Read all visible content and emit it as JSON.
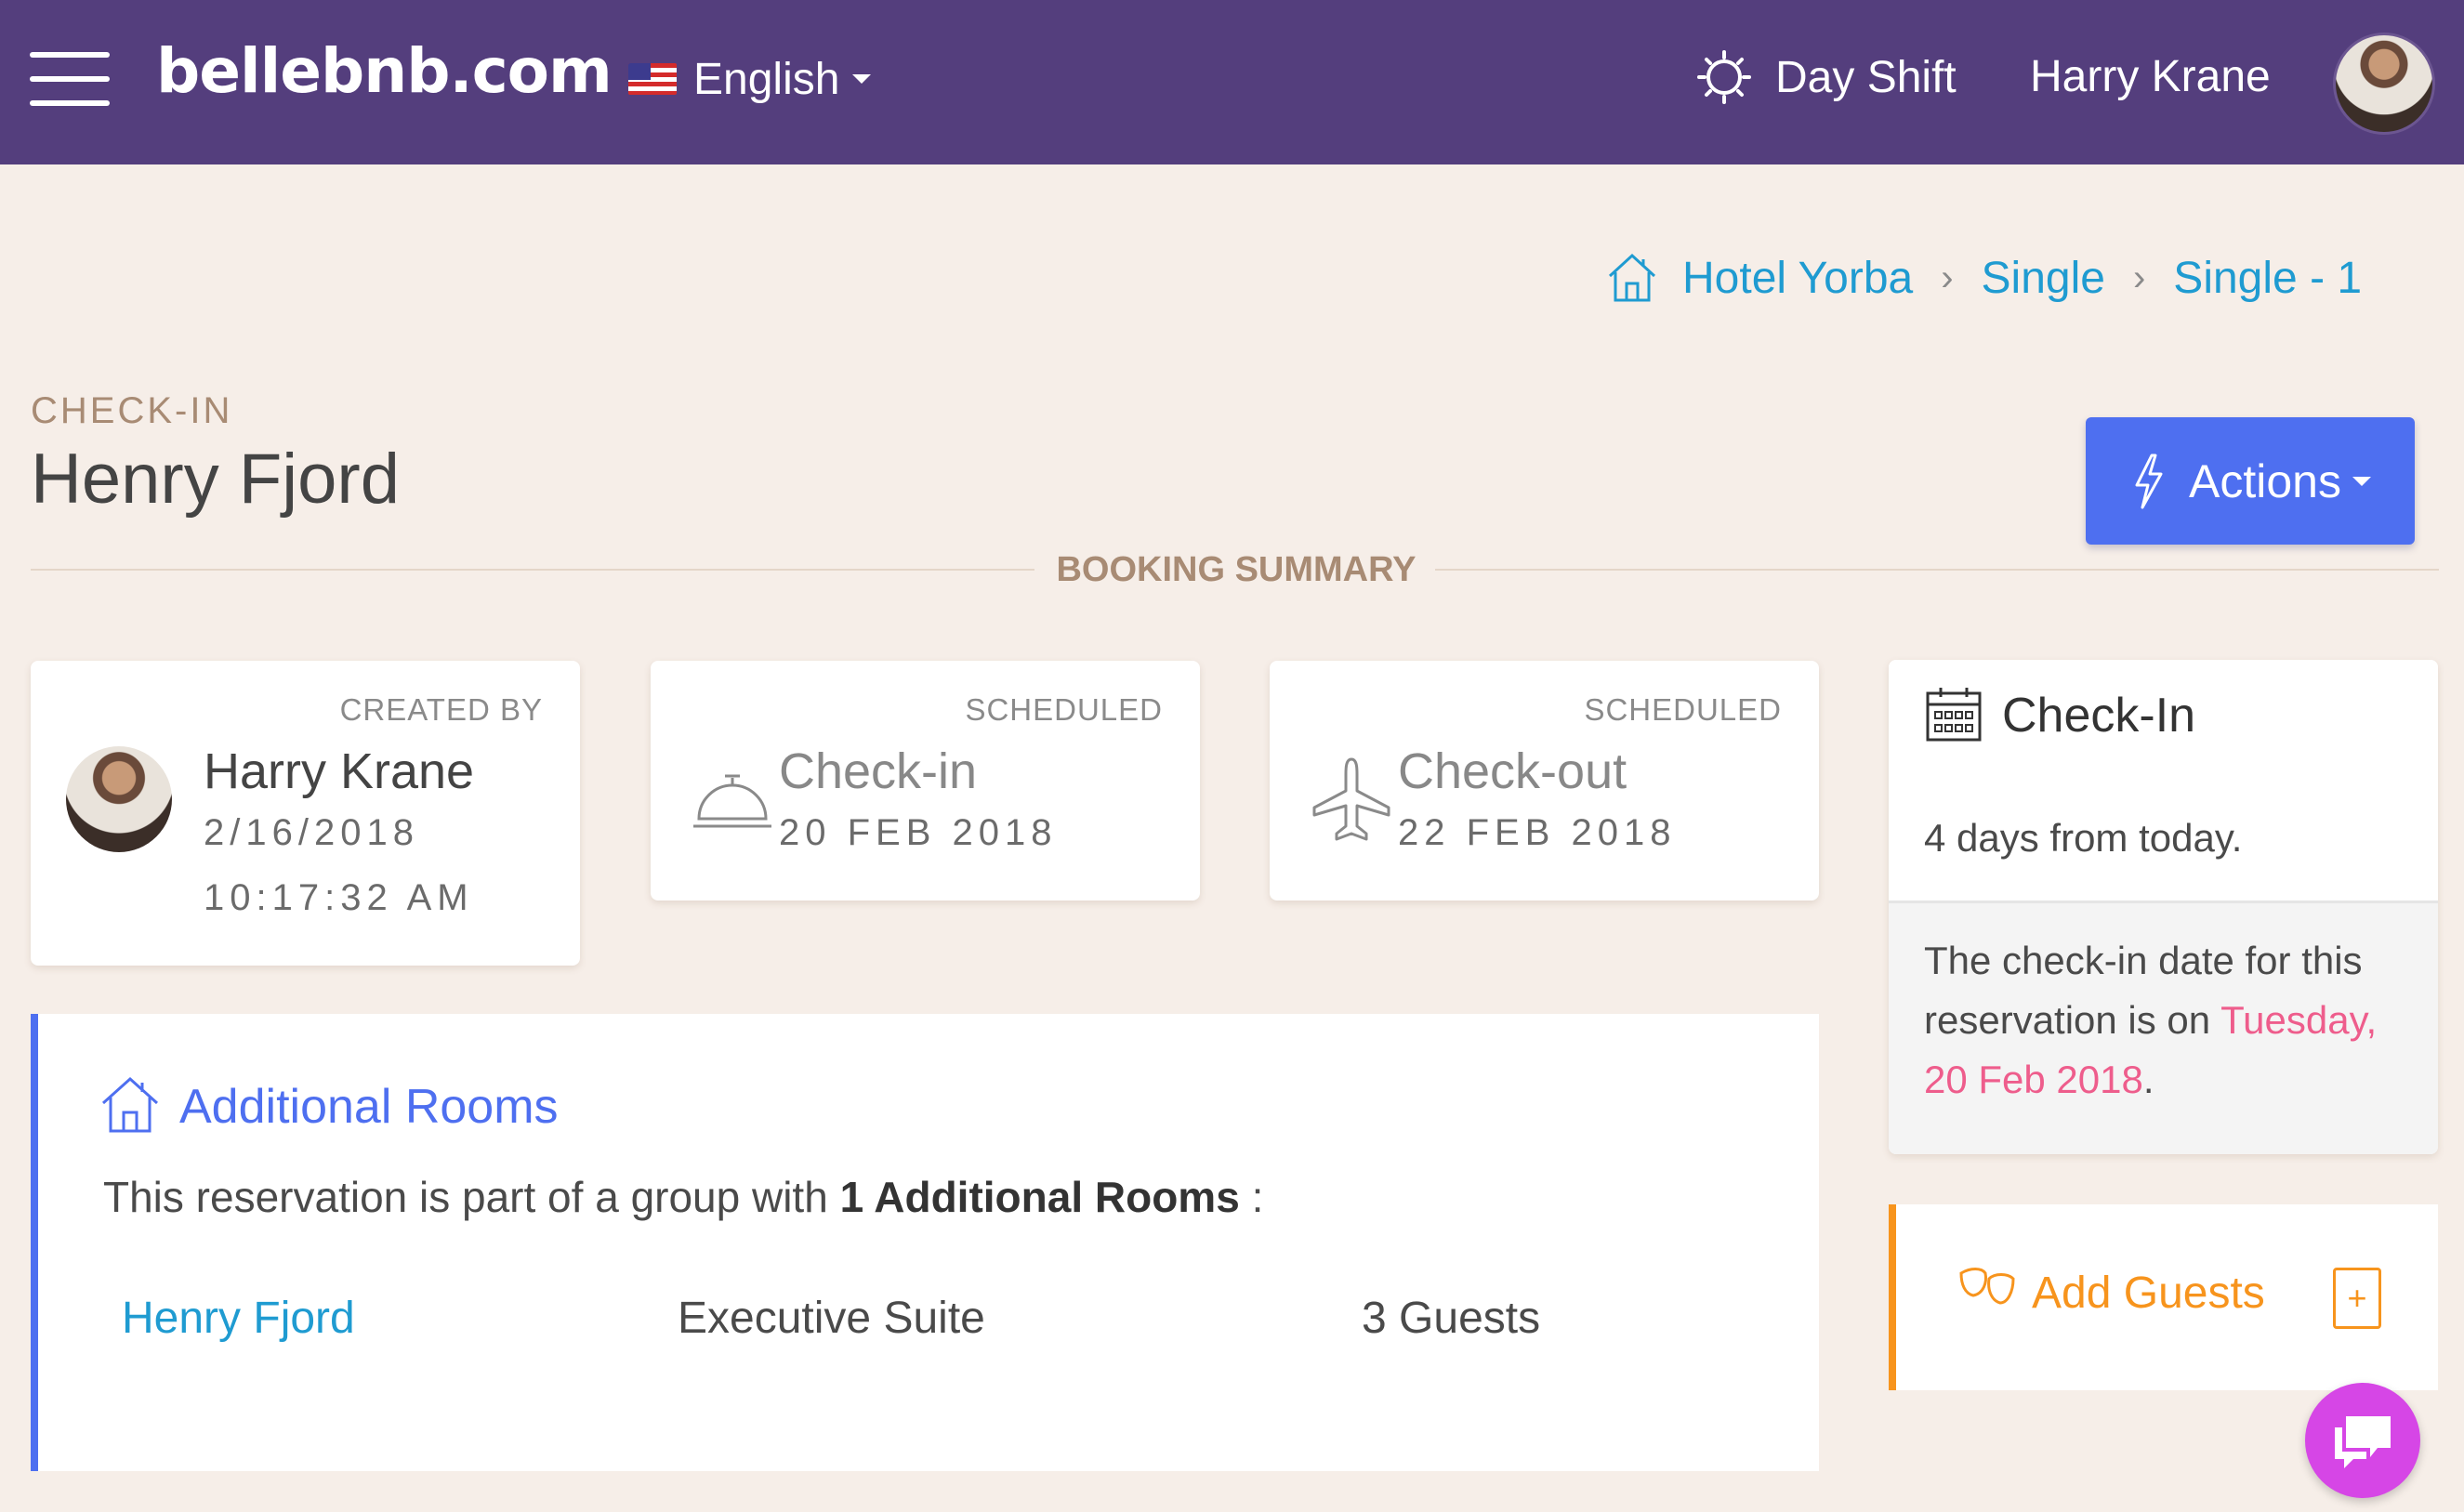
{
  "navbar": {
    "brand": "bellebnb.com",
    "language": "English",
    "shift": "Day Shift",
    "user": "Harry Krane"
  },
  "breadcrumb": [
    "Hotel Yorba",
    "Single",
    "Single - 1"
  ],
  "header": {
    "eyebrow": "CHECK-IN",
    "title": "Henry Fjord",
    "actions_label": "Actions",
    "section_title": "BOOKING SUMMARY"
  },
  "cards": {
    "created": {
      "kicker": "CREATED BY",
      "name": "Harry Krane",
      "date": "2/16/2018",
      "time": "10:17:32 AM"
    },
    "checkin": {
      "kicker": "SCHEDULED",
      "label": "Check-in",
      "date": "20 FEB 2018"
    },
    "checkout": {
      "kicker": "SCHEDULED",
      "label": "Check-out",
      "date": "22 FEB 2018"
    }
  },
  "rooms": {
    "title": "Additional Rooms",
    "desc_prefix": "This reservation is part of a group with ",
    "desc_bold": "1 Additional Rooms",
    "desc_suffix": " :",
    "items": [
      {
        "name": "Henry Fjord",
        "type": "Executive Suite",
        "guests": "3 Guests"
      }
    ]
  },
  "checkin_panel": {
    "title": "Check-In",
    "countdown": "4 days from today.",
    "text_prefix": "The check-in date for this reservation is on ",
    "date": "Tuesday, 20 Feb 2018",
    "text_suffix": "."
  },
  "guests_panel": {
    "label": "Add Guests",
    "plus": "+"
  },
  "colors": {
    "navbar": "#543e7d",
    "accent_blue": "#4e6ff0",
    "link": "#1f9bd1",
    "orange": "#f7941d",
    "pink": "#ee5d8c",
    "chat": "#d646e6"
  }
}
